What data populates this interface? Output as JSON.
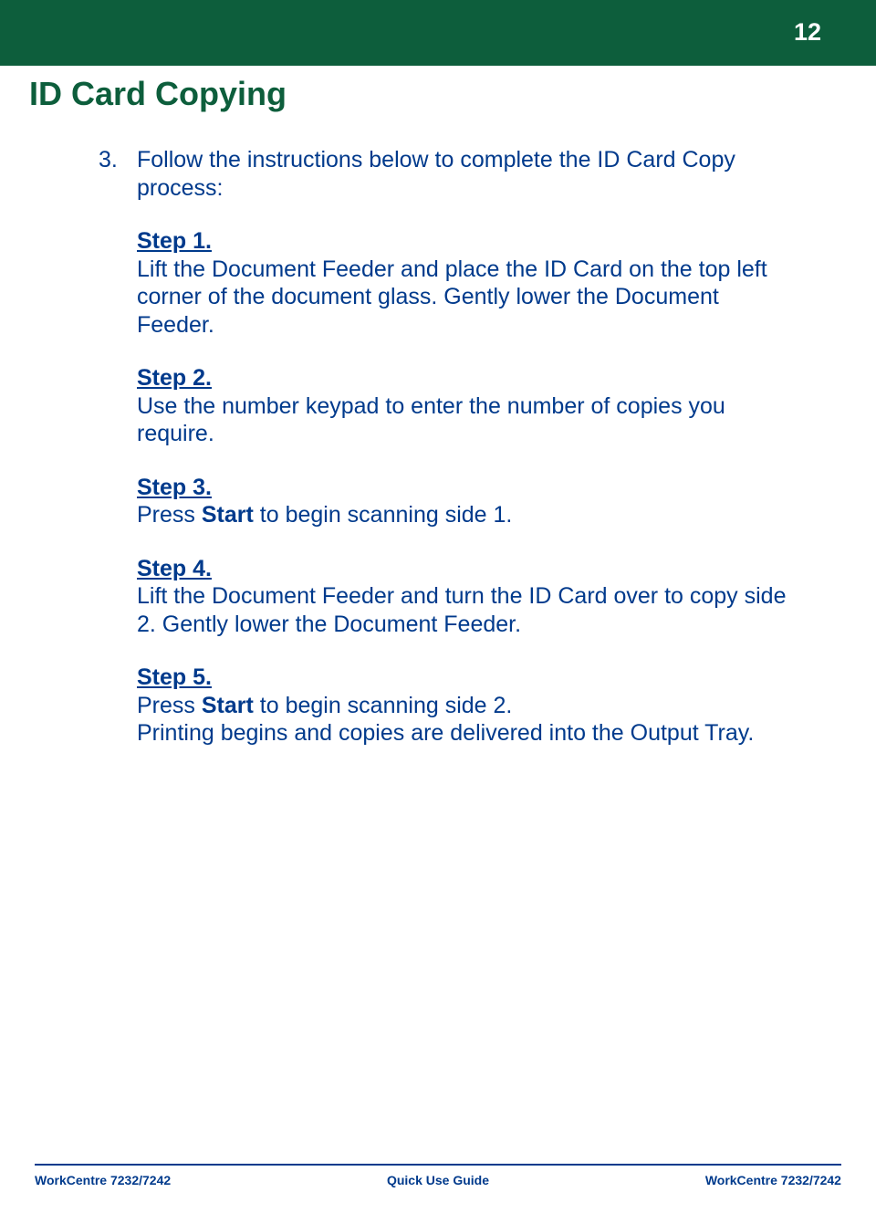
{
  "header": {
    "page_number": "12",
    "title": "ID Card Copying"
  },
  "content": {
    "list_number": "3.",
    "intro": "Follow the instructions below to complete the  ID Card Copy process:",
    "steps": [
      {
        "heading": "Step 1.",
        "body": "Lift the Document Feeder and place the ID Card on the top left corner of the document glass.  Gently lower the Document Feeder."
      },
      {
        "heading": "Step 2.",
        "body": "Use the number keypad to enter the number of copies you require."
      },
      {
        "heading": "Step 3.",
        "body_pre": "Press ",
        "body_bold": "Start",
        "body_post": " to begin scanning side 1."
      },
      {
        "heading": "Step 4.",
        "body": "Lift the Document Feeder and turn the ID Card over to copy side 2.  Gently lower the Document Feeder."
      },
      {
        "heading": "Step 5.",
        "body_pre": "Press ",
        "body_bold": "Start",
        "body_post": " to begin scanning side 2.",
        "body_extra": "Printing begins and copies are delivered into the Output Tray."
      }
    ]
  },
  "footer": {
    "left": "WorkCentre 7232/7242",
    "center": "Quick Use Guide",
    "right": "WorkCentre 7232/7242"
  }
}
